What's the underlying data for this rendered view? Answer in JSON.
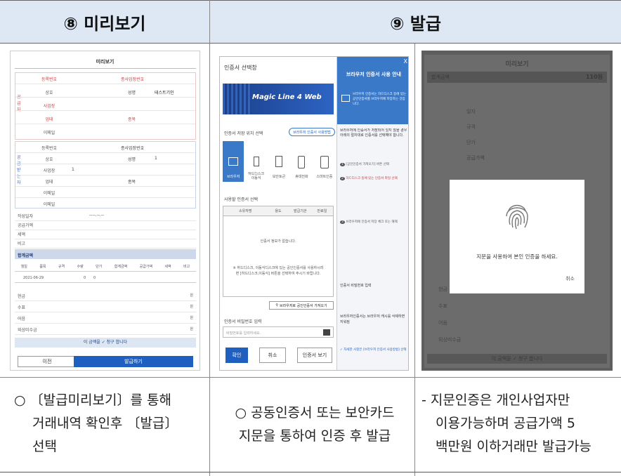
{
  "headers": {
    "preview": "⑧ 미리보기",
    "issue": "⑨ 발급"
  },
  "preview_panel": {
    "title": "미리보기",
    "supplier_side": "공급자",
    "receiver_side": "공급받는자",
    "supplier_rows": [
      "등록번호",
      "상호",
      "사업장",
      "업태",
      "이메일"
    ],
    "supplier_right": {
      "sub_reg": "종사업장번호",
      "name_label": "성명",
      "name_value": "테스트기인",
      "item_label": "종목"
    },
    "receiver_rows": [
      "등록번호",
      "상호",
      "사업장",
      "업태",
      "이메일",
      "이메일"
    ],
    "receiver_right": {
      "sub_reg": "종사업장번호",
      "name_label": "성명",
      "name_value": "1",
      "item_label": "종목",
      "addr_value": "1"
    },
    "summary_rows": [
      "작성일자",
      "공급가액",
      "세액",
      "비고"
    ],
    "date_value": "----.--.--",
    "total_label": "합계금액",
    "item_header": [
      "월일",
      "품목",
      "규격",
      "수량",
      "단가",
      "합계금액",
      "공급가액",
      "세액",
      "비고"
    ],
    "item_row": [
      "2021-06-29",
      "0",
      "0"
    ],
    "payment_rows": [
      "현금",
      "수표",
      "어음",
      "외상미수금"
    ],
    "won": "원",
    "claim_text": "이 금액을 ✓ 청구 합니다",
    "prev_button": "이전",
    "issue_button": "발급하기"
  },
  "cert_panel": {
    "title": "인증서 선택창",
    "logo": "Magic Line 4 Web",
    "storage_label": "인증서 저장 위치 선택",
    "browser_cert_help": "브라우저 인증서 사용방법",
    "storage_items": [
      "브라우저",
      "하드디스크 이동식",
      "보안토큰",
      "휴대전화",
      "스마트인증"
    ],
    "cert_list_label": "사용할 인증서 선택",
    "cert_columns": [
      "소유자명",
      "용도",
      "발급기관",
      "만료일"
    ],
    "no_cert": "인증서 정보가 없습니다.",
    "hint": "※ 하드디스크, 이동식디스크에 있는 공인인증서를 사용하시려면 [하드디스크,이동식] 버튼을 선택하여 주시기 바랍니다.",
    "search_button": "브라우저로 공인인증서 가져오기",
    "password_label": "인증서 비밀번호 입력",
    "password_placeholder": "비밀번호를 입력하세요.",
    "ok": "확인",
    "cancel": "취소",
    "view": "인증서 보기",
    "info_title": "브라우저 인증서 사용 안내",
    "info_items": [
      "브라우저 인증서는 하드디스크 등에 있는 공인인증서를 브라우저에 저장하는 것입니다.",
      "브라우저에 인증서가 저장되어 있지 않을 경우 아래의 절차대로 인증서를 선택해야 합니다."
    ],
    "info_steps": [
      "[공인인증서 가져오기] 버튼 선택",
      "하드디스크 등에 있는 인증서 파일 선택",
      "브라우저에 인증서 저장 체크 또는 해제"
    ],
    "info_password": "인증서 비밀번호 입력",
    "info_foot": "브라우저인증서는 브라우저 캐시를 삭제하면 지워짐",
    "info_check": "✓ 자세한 사항은 [브라우저 인증서 사용방법] 선택",
    "close": "X"
  },
  "fingerprint_panel": {
    "bg_title": "미리보기",
    "bg_total": "합계금액",
    "bg_amount": "110원",
    "modal_text": "지문을 사용하여 본인 인증을 하세요.",
    "cancel": "취소",
    "bg_rows": [
      "일자",
      "규격",
      "단가",
      "공급가액",
      "현금",
      "수표",
      "어음",
      "외상미수금"
    ],
    "bg_claim": "이 금액을 ✓ 청구 합니다"
  },
  "captions": {
    "col1": [
      "○ 〔발급미리보기〕를 통해",
      "거래내역 확인후 〔발급〕",
      "선택"
    ],
    "col2": [
      "○ 공동인증서 또는 보안카드",
      "지문을 통하여 인증 후 발급"
    ],
    "col3": [
      "- 지문인증은 개인사업자만",
      "이용가능하며 공급가액 5",
      "백만원 이하거래만 발급가능"
    ]
  },
  "colors": {
    "header_bg": "#dde8f4",
    "primary": "#1f5fbf",
    "cert_blue": "#3a78c8"
  }
}
